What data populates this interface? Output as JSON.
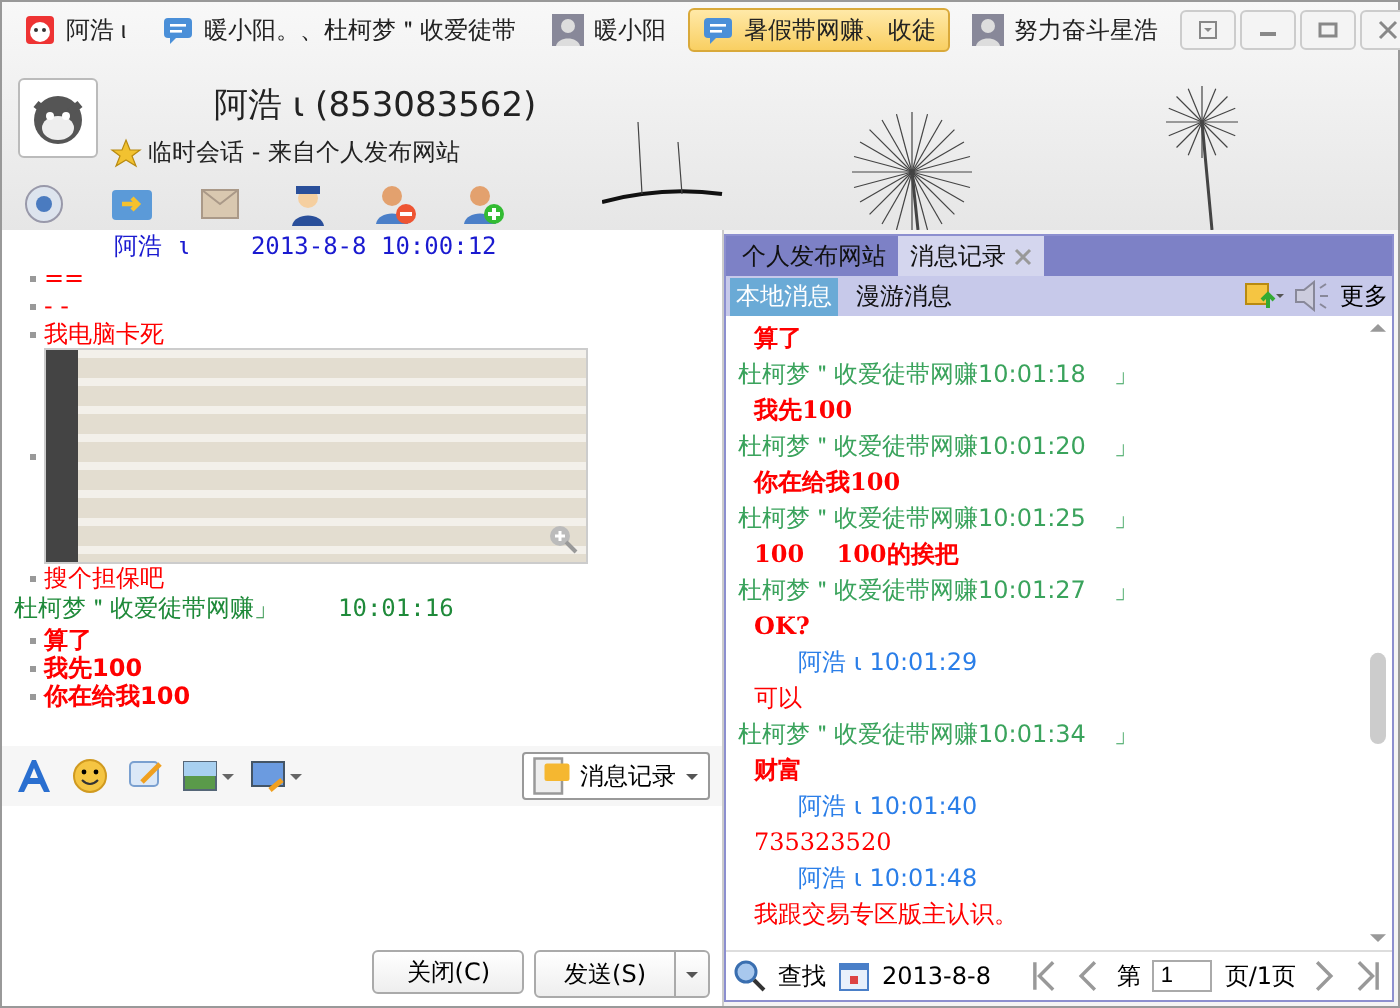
{
  "title_tabs": [
    {
      "label": "阿浩 ι",
      "selected": false,
      "kind": "fox"
    },
    {
      "label": "暖小阳。、杜柯梦＂收爱徒带",
      "selected": false,
      "kind": "group"
    },
    {
      "label": "暖小阳",
      "selected": false,
      "kind": "person"
    },
    {
      "label": "暑假带网赚、收徒",
      "selected": true,
      "kind": "group"
    },
    {
      "label": "努力奋斗星浩",
      "selected": false,
      "kind": "person"
    }
  ],
  "contact": {
    "name": "阿浩 ι (853083562)",
    "subtitle": "临时会话 - 来自个人发布网站"
  },
  "chat": [
    {
      "kind": "header",
      "sender": "阿浩 ι",
      "time": "2013-8-8 10:00:12",
      "color": "#1a1ad0"
    },
    {
      "kind": "text",
      "text": "==",
      "bold": false
    },
    {
      "kind": "text",
      "text": "- -",
      "bold": false
    },
    {
      "kind": "text",
      "text": "我电脑卡死",
      "bold": false
    },
    {
      "kind": "image"
    },
    {
      "kind": "text",
      "text": "搜个担保吧",
      "bold": false
    },
    {
      "kind": "header",
      "sender": "杜柯梦＂收爱徒带网赚」",
      "time": "10:01:16",
      "color": "#1f8a3a"
    },
    {
      "kind": "text",
      "text": "算了",
      "bold": true
    },
    {
      "kind": "text",
      "text": "我先100",
      "bold": true
    },
    {
      "kind": "text",
      "text": "你在给我100",
      "bold": true
    }
  ],
  "history_button": "消息记录",
  "buttons": {
    "close": "关闭(C)",
    "send": "发送(S)"
  },
  "side_tabs": [
    {
      "label": "个人发布网站",
      "selected": false,
      "closable": false
    },
    {
      "label": "消息记录",
      "selected": true,
      "closable": true
    }
  ],
  "sub_tabs": [
    {
      "label": "本地消息",
      "selected": true
    },
    {
      "label": "漫游消息",
      "selected": false
    }
  ],
  "more": "更多",
  "history": [
    {
      "kind": "message",
      "text": "算了",
      "bold": true
    },
    {
      "kind": "peer_header",
      "sender": "杜柯梦＂收爱徒带网赚",
      "time": "10:01:18",
      "tail": "」"
    },
    {
      "kind": "message",
      "text": "我先100",
      "bold": true
    },
    {
      "kind": "peer_header",
      "sender": "杜柯梦＂收爱徒带网赚",
      "time": "10:01:20",
      "tail": "」"
    },
    {
      "kind": "message",
      "text": "你在给我100",
      "bold": true
    },
    {
      "kind": "peer_header",
      "sender": "杜柯梦＂收爱徒带网赚",
      "time": "10:01:25",
      "tail": "」"
    },
    {
      "kind": "message",
      "text": "100　 100的挨把",
      "bold": true
    },
    {
      "kind": "peer_header",
      "sender": "杜柯梦＂收爱徒带网赚",
      "time": "10:01:27",
      "tail": "」"
    },
    {
      "kind": "message",
      "text": "OK?",
      "bold": true
    },
    {
      "kind": "own_header",
      "sender": "阿浩 ι",
      "time": "10:01:29"
    },
    {
      "kind": "message",
      "text": "可以",
      "bold": false
    },
    {
      "kind": "peer_header",
      "sender": "杜柯梦＂收爱徒带网赚",
      "time": "10:01:34",
      "tail": "」"
    },
    {
      "kind": "message",
      "text": "财富",
      "bold": true
    },
    {
      "kind": "own_header",
      "sender": "阿浩 ι",
      "time": "10:01:40"
    },
    {
      "kind": "message",
      "text": "735323520",
      "bold": false
    },
    {
      "kind": "own_header",
      "sender": "阿浩 ι",
      "time": "10:01:48"
    },
    {
      "kind": "message",
      "text": "我跟交易专区版主认识。",
      "bold": false
    }
  ],
  "footer": {
    "search": "查找",
    "date": "2013-8-8",
    "page_prefix": "第",
    "page": "1",
    "page_suffix": "页/1页"
  }
}
